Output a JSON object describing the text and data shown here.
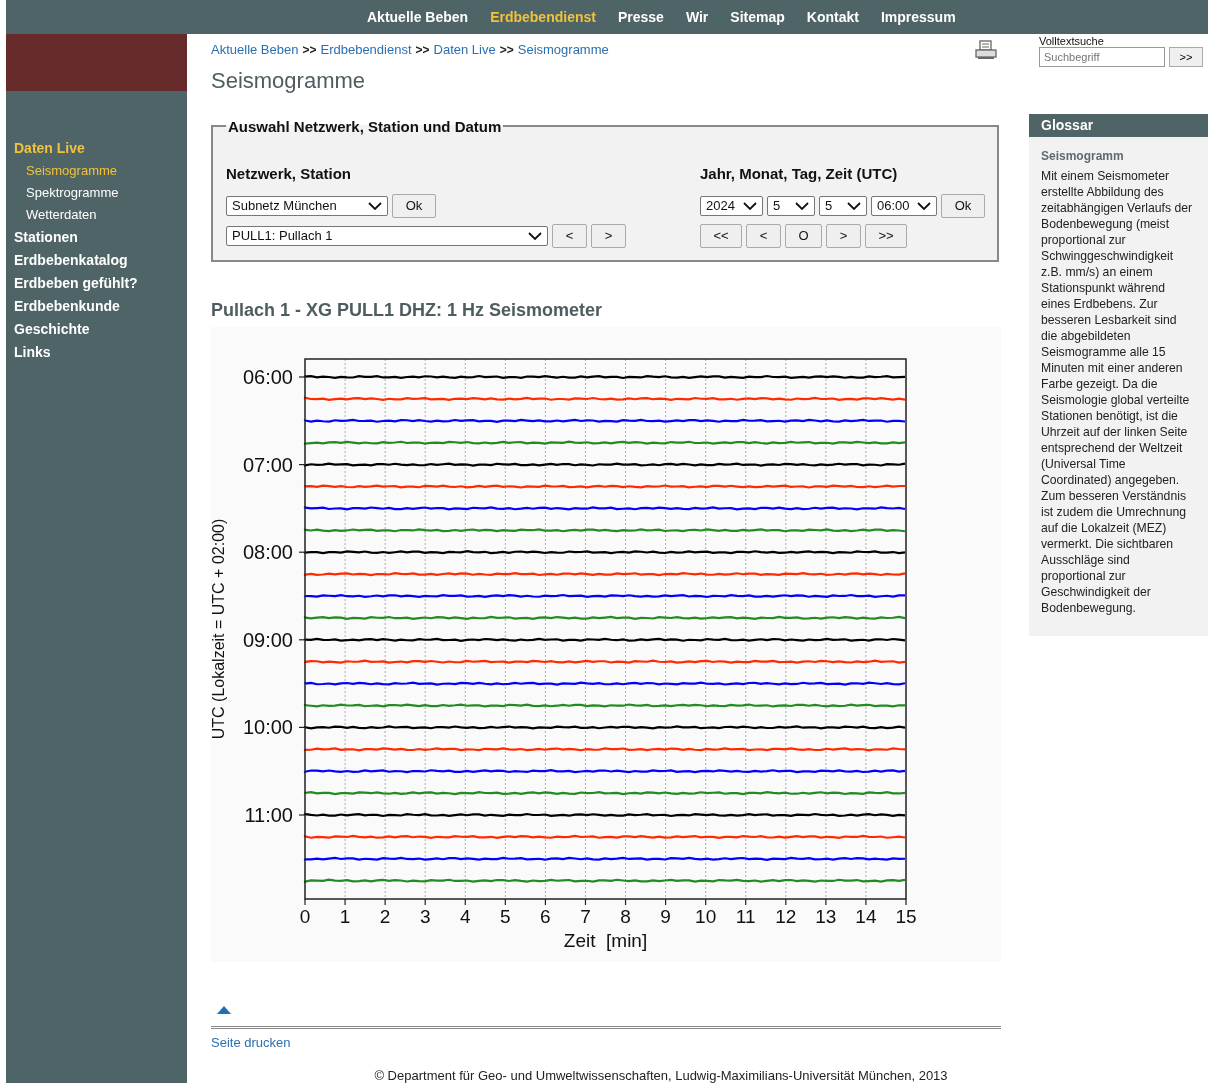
{
  "top_nav": [
    {
      "label": "Aktuelle Beben",
      "selected": false
    },
    {
      "label": "Erdbebendienst",
      "selected": true
    },
    {
      "label": "Presse",
      "selected": false
    },
    {
      "label": "Wir",
      "selected": false
    },
    {
      "label": "Sitemap",
      "selected": false
    },
    {
      "label": "Kontakt",
      "selected": false
    },
    {
      "label": "Impressum",
      "selected": false
    }
  ],
  "sidebar": {
    "items": [
      {
        "label": "Daten Live",
        "selected": true,
        "children": [
          {
            "label": "Seismogramme",
            "selected": true
          },
          {
            "label": "Spektrogramme",
            "selected": false
          },
          {
            "label": "Wetterdaten",
            "selected": false
          }
        ]
      },
      {
        "label": "Stationen",
        "selected": false
      },
      {
        "label": "Erdbebenkatalog",
        "selected": false
      },
      {
        "label": "Erdbeben gefühlt?",
        "selected": false
      },
      {
        "label": "Erdbebenkunde",
        "selected": false
      },
      {
        "label": "Geschichte",
        "selected": false
      },
      {
        "label": "Links",
        "selected": false
      }
    ]
  },
  "breadcrumb": {
    "items": [
      "Aktuelle Beben",
      "Erdbebendienst",
      "Daten Live",
      "Seismogramme"
    ],
    "separator": ">>"
  },
  "page_title": "Seismogramme",
  "search": {
    "label": "Volltextsuche",
    "placeholder": "Suchbegriff",
    "button": ">>"
  },
  "form": {
    "legend": "Auswahl Netzwerk, Station und Datum",
    "left": {
      "heading": "Netzwerk, Station",
      "network": "Subnetz München",
      "ok": "Ok",
      "station": "PULL1: Pullach 1",
      "nav": [
        "<",
        ">"
      ]
    },
    "right": {
      "heading": "Jahr, Monat, Tag, Zeit (UTC)",
      "selects": [
        "2024",
        "5",
        "5",
        "06:00"
      ],
      "ok": "Ok",
      "nav": [
        "<<",
        "<",
        "O",
        ">",
        ">>"
      ]
    }
  },
  "plot": {
    "title": "Pullach 1 - XG PULL1 DHZ: 1 Hz Seismometer",
    "xlabel": "Zeit  [min]",
    "ylabel": "UTC (Lokalzeit = UTC + 02:00)",
    "xticks": [
      "0",
      "1",
      "2",
      "3",
      "4",
      "5",
      "6",
      "7",
      "8",
      "9",
      "10",
      "11",
      "12",
      "13",
      "14",
      "15"
    ],
    "yticks": [
      "06:00",
      "07:00",
      "08:00",
      "09:00",
      "10:00",
      "11:00"
    ],
    "traces": [
      {
        "color": "#000000"
      },
      {
        "color": "#ff2a00"
      },
      {
        "color": "#0000ff"
      },
      {
        "color": "#228b22"
      }
    ]
  },
  "glossary": {
    "header": "Glossar",
    "term": "Seismogramm",
    "text": "Mit einem Seismometer erstellte Abbildung des zeitabhängigen Verlaufs der Bodenbewegung (meist proportional zur Schwinggeschwindigkeit z.B. mm/s) an einem Stationspunkt während eines Erdbebens. Zur besseren Lesbarkeit sind die abgebildeten Seismogramme alle 15 Minuten mit einer anderen Farbe gezeigt. Da die Seismologie global verteilte Stationen benötigt, ist die Uhrzeit auf der linken Seite entsprechend der Weltzeit (Universal Time Coordinated) angegeben. Zum besseren Verständnis ist zudem die Umrechnung auf die Lokalzeit (MEZ) vermerkt. Die sichtbaren Ausschläge sind proportional zur Geschwindigkeit der Bodenbewegung."
  },
  "print_link": "Seite drucken",
  "footer": "© Department für Geo- und Umweltwissenschaften, Ludwig-Maximilians-Universität München, 2013"
}
